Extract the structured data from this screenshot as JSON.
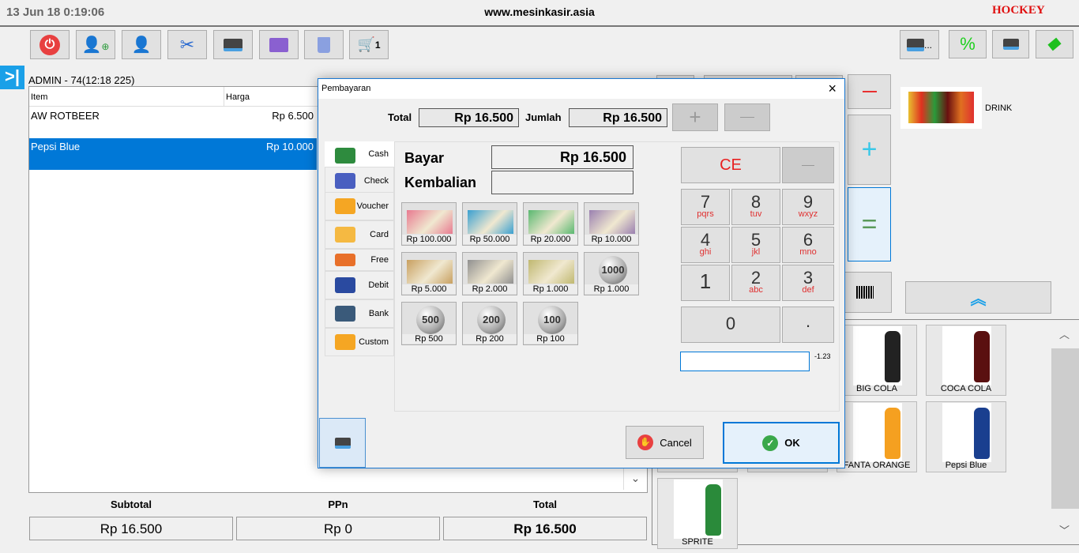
{
  "header": {
    "datetime": "13 Jun 18  0:19:06",
    "site": "www.mesinkasir.asia",
    "logo": "HOCKEY"
  },
  "toolbar": {
    "cart_count": "1",
    "printer_more": "..."
  },
  "session": {
    "label": "ADMIN -  74(12:18 225)"
  },
  "table": {
    "columns": [
      "Item",
      "Harga"
    ],
    "rows": [
      {
        "item": "AW ROTBEER",
        "price": "Rp 6.500",
        "selected": false
      },
      {
        "item": "Pepsi Blue",
        "price": "Rp 10.000",
        "selected": true
      }
    ]
  },
  "summary": {
    "subtotal_label": "Subtotal",
    "subtotal": "Rp 16.500",
    "ppn_label": "PPn",
    "ppn": "Rp 0",
    "total_label": "Total",
    "total": "Rp 16.500"
  },
  "category": {
    "label": "DRINK"
  },
  "products": [
    {
      "name": "BIG COLA",
      "color": "#222"
    },
    {
      "name": "COCA COLA",
      "color": "#5a1010"
    },
    {
      "name": "FANTA ORANGE",
      "color": "#f5a020"
    },
    {
      "name": "Pepsi Blue",
      "color": "#1a3f8f"
    },
    {
      "name": "SPRITE",
      "color": "#2a8a3a"
    }
  ],
  "dialog": {
    "title": "Pembayaran",
    "total_label": "Total",
    "total": "Rp 16.500",
    "jumlah_label": "Jumlah",
    "jumlah": "Rp 16.500",
    "bayar_label": "Bayar",
    "bayar": "Rp 16.500",
    "kembalian_label": "Kembalian",
    "kembalian": "",
    "tabs": [
      {
        "label": "Cash",
        "color": "#2e8b3e",
        "active": true
      },
      {
        "label": "Check",
        "color": "#4a5fc0"
      },
      {
        "label": "Voucher",
        "color": "#f5a623"
      },
      {
        "label": "Card",
        "color": "#f5b942"
      },
      {
        "label": "Free",
        "color": "#e8702a"
      },
      {
        "label": "Debit",
        "color": "#2a4aa0"
      },
      {
        "label": "Bank",
        "color": "#3a5a7a"
      },
      {
        "label": "Custom",
        "color": "#f5a623"
      }
    ],
    "denominations": [
      {
        "label": "Rp 100.000",
        "color": "#e87a90",
        "type": "note"
      },
      {
        "label": "Rp 50.000",
        "color": "#3aa0d0",
        "type": "note"
      },
      {
        "label": "Rp 20.000",
        "color": "#5ab870",
        "type": "note"
      },
      {
        "label": "Rp 10.000",
        "color": "#9a80b0",
        "type": "note"
      },
      {
        "label": "Rp 5.000",
        "color": "#c8a060",
        "type": "note"
      },
      {
        "label": "Rp 2.000",
        "color": "#909090",
        "type": "note"
      },
      {
        "label": "Rp 1.000",
        "color": "#c0b870",
        "type": "note"
      },
      {
        "label": "Rp 1.000",
        "coin": "1000",
        "type": "coin"
      },
      {
        "label": "Rp 500",
        "coin": "500",
        "type": "coin"
      },
      {
        "label": "Rp 200",
        "coin": "200",
        "type": "coin"
      },
      {
        "label": "Rp 100",
        "coin": "100",
        "type": "coin"
      }
    ],
    "keypad": {
      "ce": "CE",
      "keys": [
        {
          "n": "7",
          "s": "pqrs"
        },
        {
          "n": "8",
          "s": "tuv"
        },
        {
          "n": "9",
          "s": "wxyz"
        },
        {
          "n": "4",
          "s": "ghi"
        },
        {
          "n": "5",
          "s": "jkl"
        },
        {
          "n": "6",
          "s": "mno"
        },
        {
          "n": "1",
          "s": ""
        },
        {
          "n": "2",
          "s": "abc"
        },
        {
          "n": "3",
          "s": "def"
        }
      ],
      "zero": "0",
      "dot": "."
    },
    "input_value": "",
    "hint": "-1.23",
    "cancel": "Cancel",
    "ok": "OK"
  }
}
